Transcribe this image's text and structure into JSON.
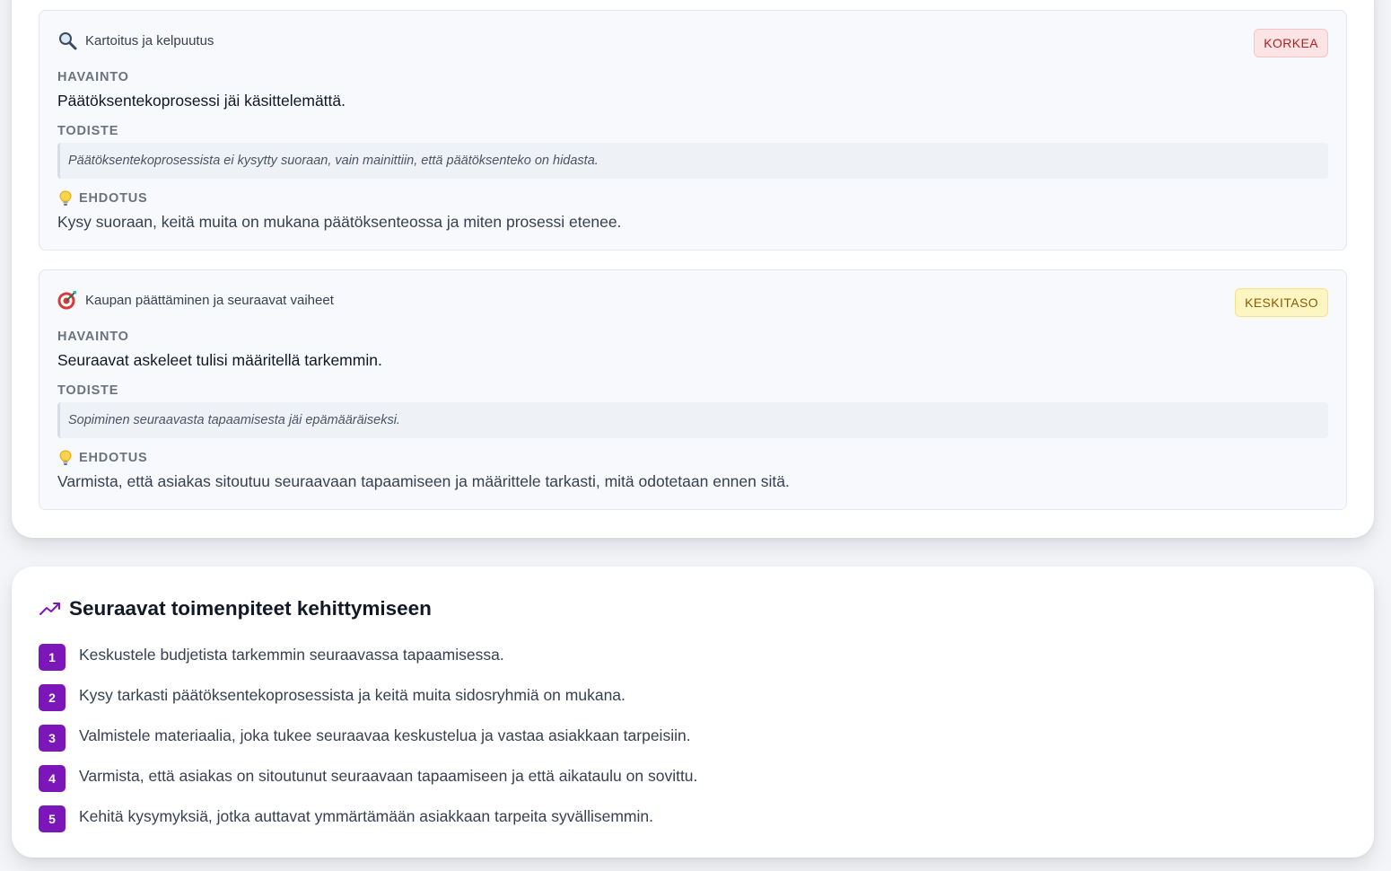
{
  "findings": [
    {
      "category": "Kartoitus ja kelpuutus",
      "category_icon": "magnifier-icon",
      "severity": "KORKEA",
      "severity_color": "#b91c1c",
      "observation_label": "HAVAINTO",
      "observation": "Päätöksentekoprosessi jäi käsittelemättä.",
      "evidence_label": "TODISTE",
      "evidence": "Päätöksentekoprosessista ei kysytty suoraan, vain mainittiin, että päätöksenteko on hidasta.",
      "suggestion_label": "EHDOTUS",
      "suggestion": "Kysy suoraan, keitä muita on mukana päätöksenteossa ja miten prosessi etenee."
    },
    {
      "category": "Kaupan päättäminen ja seuraavat vaiheet",
      "category_icon": "target-icon",
      "severity": "KESKITASO",
      "severity_color": "#8a5a06",
      "observation_label": "HAVAINTO",
      "observation": "Seuraavat askeleet tulisi määritellä tarkemmin.",
      "evidence_label": "TODISTE",
      "evidence": "Sopiminen seuraavasta tapaamisesta jäi epämääräiseksi.",
      "suggestion_label": "EHDOTUS",
      "suggestion": "Varmista, että asiakas sitoutuu seuraavaan tapaamiseen ja määrittele tarkasti, mitä odotetaan ennen sitä."
    }
  ],
  "next_steps": {
    "title": "Seuraavat toimenpiteet kehittymiseen",
    "icon": "trending-up-icon",
    "accent_color": "#7c16b8",
    "items": [
      {
        "number": "1",
        "text": "Keskustele budjetista tarkemmin seuraavassa tapaamisessa."
      },
      {
        "number": "2",
        "text": "Kysy tarkasti päätöksentekoprosessista ja keitä muita sidosryhmiä on mukana."
      },
      {
        "number": "3",
        "text": "Valmistele materiaalia, joka tukee seuraavaa keskustelua ja vastaa asiakkaan tarpeisiin."
      },
      {
        "number": "4",
        "text": "Varmista, että asiakas on sitoutunut seuraavaan tapaamiseen ja että aikataulu on sovittu."
      },
      {
        "number": "5",
        "text": "Kehitä kysymyksiä, jotka auttavat ymmärtämään asiakkaan tarpeita syvällisemmin."
      }
    ]
  }
}
